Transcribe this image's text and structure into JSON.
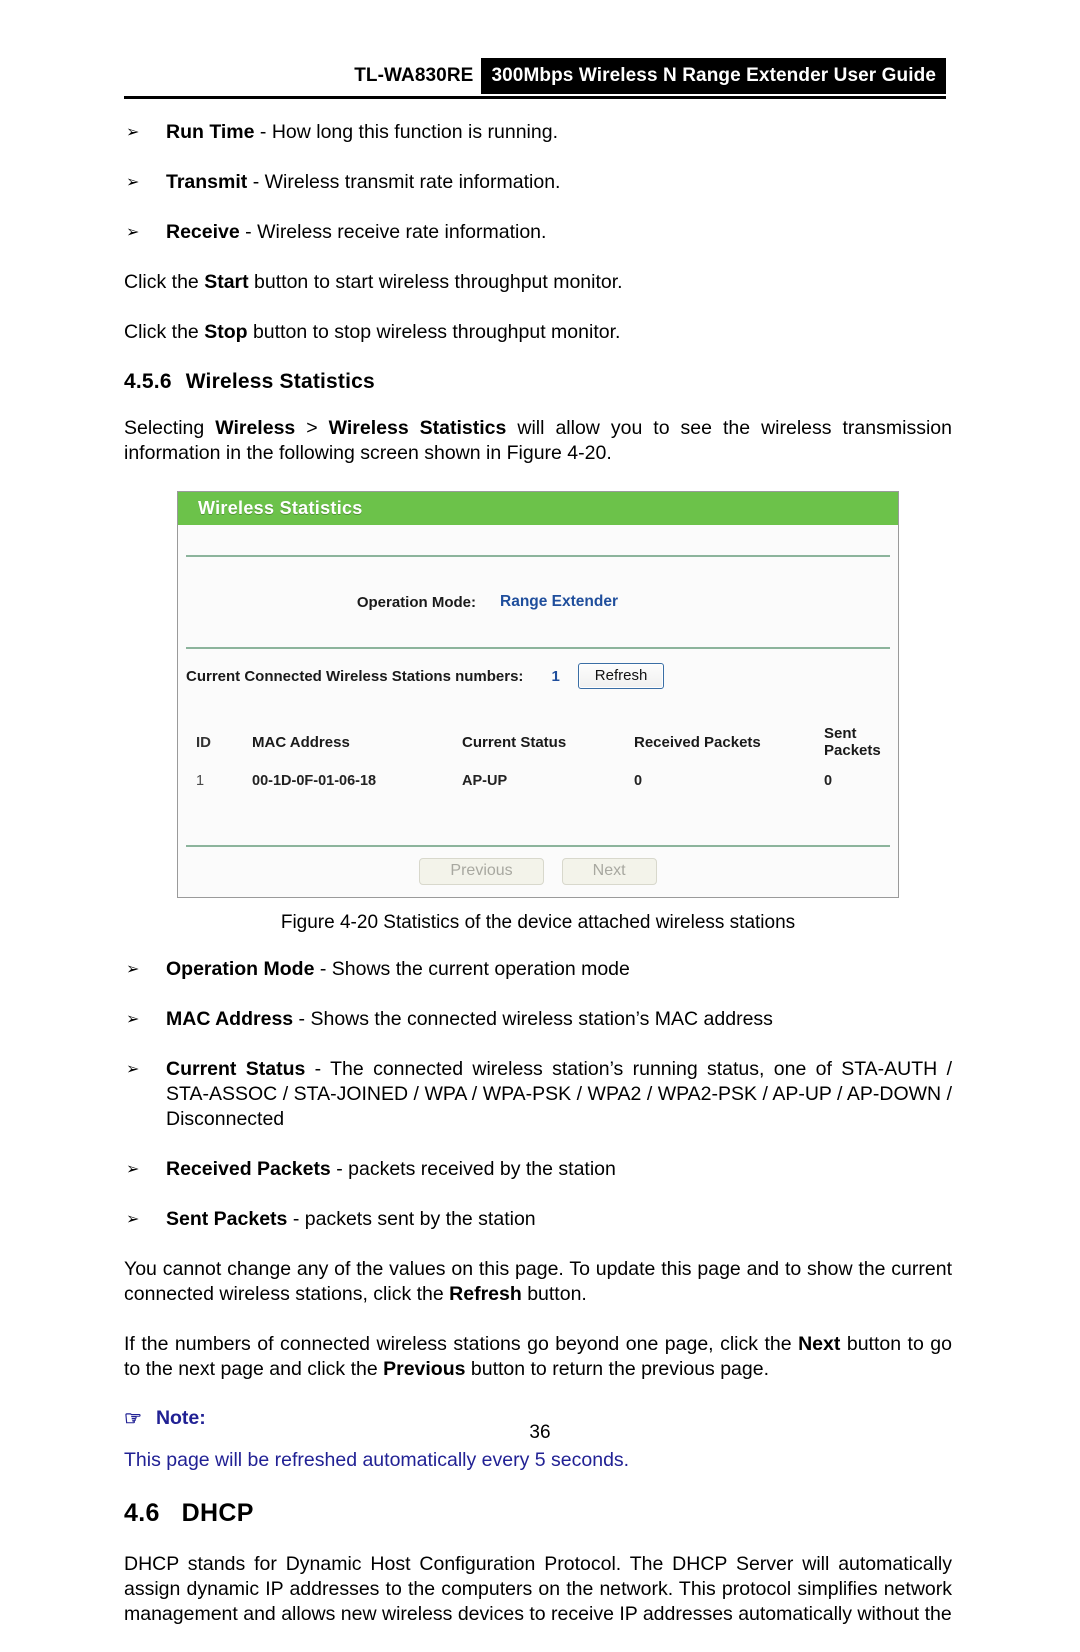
{
  "header": {
    "model": "TL-WA830RE",
    "guide_title": "300Mbps Wireless N Range Extender User Guide"
  },
  "intro_bullets": [
    {
      "marker": "➢",
      "term": "Run Time",
      "sep": " - ",
      "desc": "How long this function is running."
    },
    {
      "marker": "➢",
      "term": "Transmit",
      "sep": " - ",
      "desc": "Wireless transmit rate information."
    },
    {
      "marker": "➢",
      "term": "Receive",
      "sep": " - ",
      "desc": "Wireless receive rate information."
    }
  ],
  "start_para": {
    "pre": "Click the ",
    "bold": "Start",
    "post": " button to start wireless throughput monitor."
  },
  "stop_para": {
    "pre": "Click the ",
    "bold": "Stop",
    "post": " button to stop wireless throughput monitor."
  },
  "section": {
    "number": "4.5.6",
    "title": "Wireless Statistics",
    "intro_a": "Selecting ",
    "intro_b": "Wireless",
    "intro_c": " > ",
    "intro_d": "Wireless Statistics",
    "intro_e": " will allow you to see the wireless transmission information in the following screen shown in Figure 4-20."
  },
  "ui": {
    "panel_title": "Wireless Statistics",
    "operation_mode_label": "Operation Mode:",
    "operation_mode_value": "Range Extender",
    "stations_label": "Current Connected Wireless Stations numbers:",
    "stations_count": "1",
    "refresh_label": "Refresh",
    "table": {
      "headers": [
        "ID",
        "MAC Address",
        "Current Status",
        "Received Packets",
        "Sent Packets"
      ],
      "rows": [
        [
          "1",
          "00-1D-0F-01-06-18",
          "AP-UP",
          "0",
          "0"
        ]
      ]
    },
    "previous_label": "Previous",
    "next_label": "Next",
    "accent_green": "#6cc24a",
    "value_blue": "#1f4e9c"
  },
  "figure_caption": "Figure 4-20 Statistics of the device attached wireless stations",
  "field_bullets": [
    {
      "marker": "➢",
      "term": "Operation Mode",
      "sep": " - ",
      "desc": "Shows the current operation mode"
    },
    {
      "marker": "➢",
      "term": "MAC Address",
      "sep": " - ",
      "desc": "Shows the connected wireless station’s MAC address"
    },
    {
      "marker": "➢",
      "term": "Current Status",
      "sep": " - ",
      "desc": "The connected wireless station’s running status, one of STA-AUTH / STA-ASSOC / STA-JOINED / WPA / WPA-PSK / WPA2 / WPA2-PSK / AP-UP / AP-DOWN / Disconnected"
    },
    {
      "marker": "➢",
      "term": "Received Packets",
      "sep": " - ",
      "desc": "packets received by the station"
    },
    {
      "marker": "➢",
      "term": "Sent Packets",
      "sep": " - ",
      "desc": "packets sent by the station"
    }
  ],
  "refresh_para": {
    "pre": "You cannot change any of the values on this page. To update this page and to show the current connected wireless stations, click the ",
    "bold": "Refresh",
    "post": " button."
  },
  "pager_para": {
    "pre": "If the numbers of connected wireless stations go beyond one page, click the ",
    "bold1": "Next",
    "mid": " button to go to the next page and click the ",
    "bold2": "Previous",
    "post": " button to return the previous page."
  },
  "note": {
    "icon": "☞",
    "label": "Note:",
    "text": "This page will be refreshed automatically every 5 seconds.",
    "color": "#212194"
  },
  "dhcp_section": {
    "number": "4.6",
    "title": "DHCP",
    "paragraph": "DHCP stands for Dynamic Host Configuration Protocol. The DHCP Server will automatically assign dynamic IP addresses to the computers on the network. This protocol simplifies network management and allows new wireless devices to receive IP addresses automatically without the"
  },
  "page_number": "36"
}
